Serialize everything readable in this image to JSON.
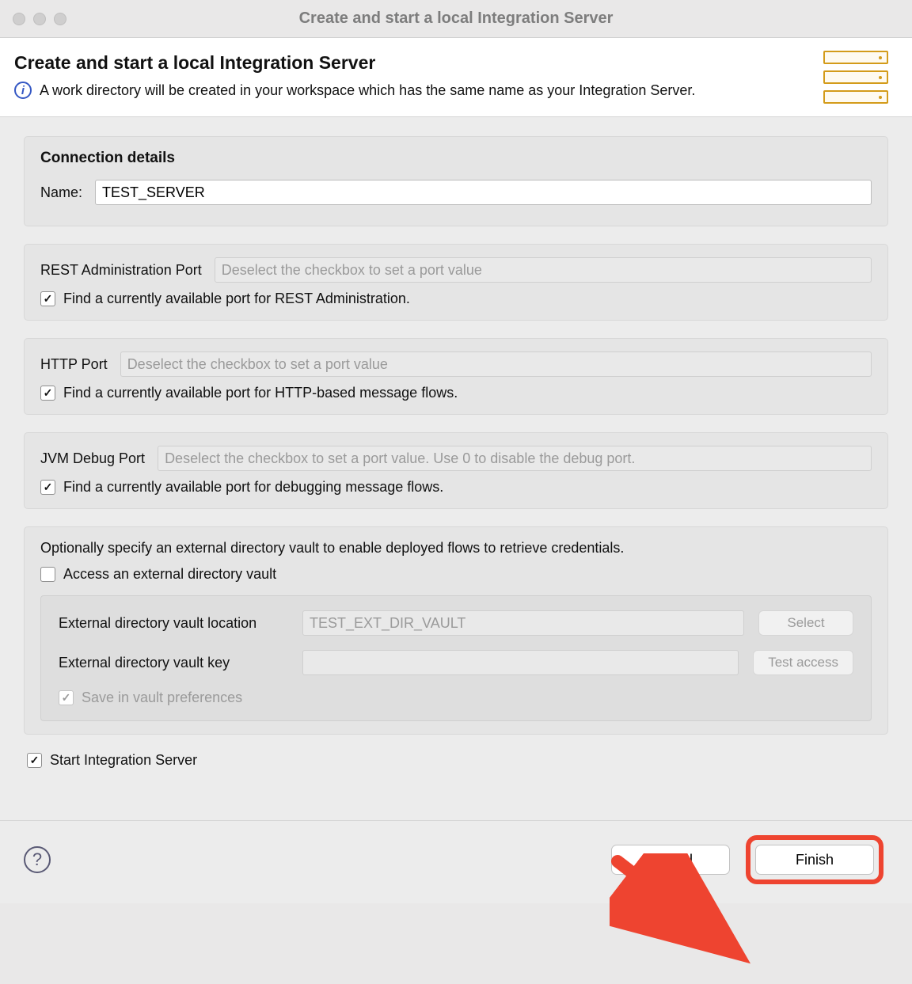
{
  "window": {
    "title": "Create and start a local Integration Server"
  },
  "header": {
    "title": "Create and start a local Integration Server",
    "description": "A work directory will be created in your workspace which has the same name as your Integration Server."
  },
  "connection": {
    "section_title": "Connection details",
    "name_label": "Name:",
    "name_value": "TEST_SERVER"
  },
  "rest": {
    "label": "REST Administration Port",
    "placeholder": "Deselect the checkbox to set a port value",
    "checkbox_label": "Find a currently available port for REST Administration."
  },
  "http": {
    "label": "HTTP Port",
    "placeholder": "Deselect the checkbox to set a port value",
    "checkbox_label": "Find a currently available port for HTTP-based message flows."
  },
  "jvm": {
    "label": "JVM Debug Port",
    "placeholder": "Deselect the checkbox to set a port value. Use 0 to disable the debug port.",
    "checkbox_label": "Find a currently available port for debugging message flows."
  },
  "vault": {
    "intro": "Optionally specify an external directory vault to enable deployed flows to retrieve credentials.",
    "access_label": "Access an external directory vault",
    "location_label": "External directory vault location",
    "location_placeholder": "TEST_EXT_DIR_VAULT",
    "select_btn": "Select",
    "key_label": "External directory vault key",
    "test_btn": "Test access",
    "save_label": "Save in vault preferences"
  },
  "start": {
    "label": "Start Integration Server"
  },
  "footer": {
    "cancel": "Cancel",
    "finish": "Finish"
  }
}
